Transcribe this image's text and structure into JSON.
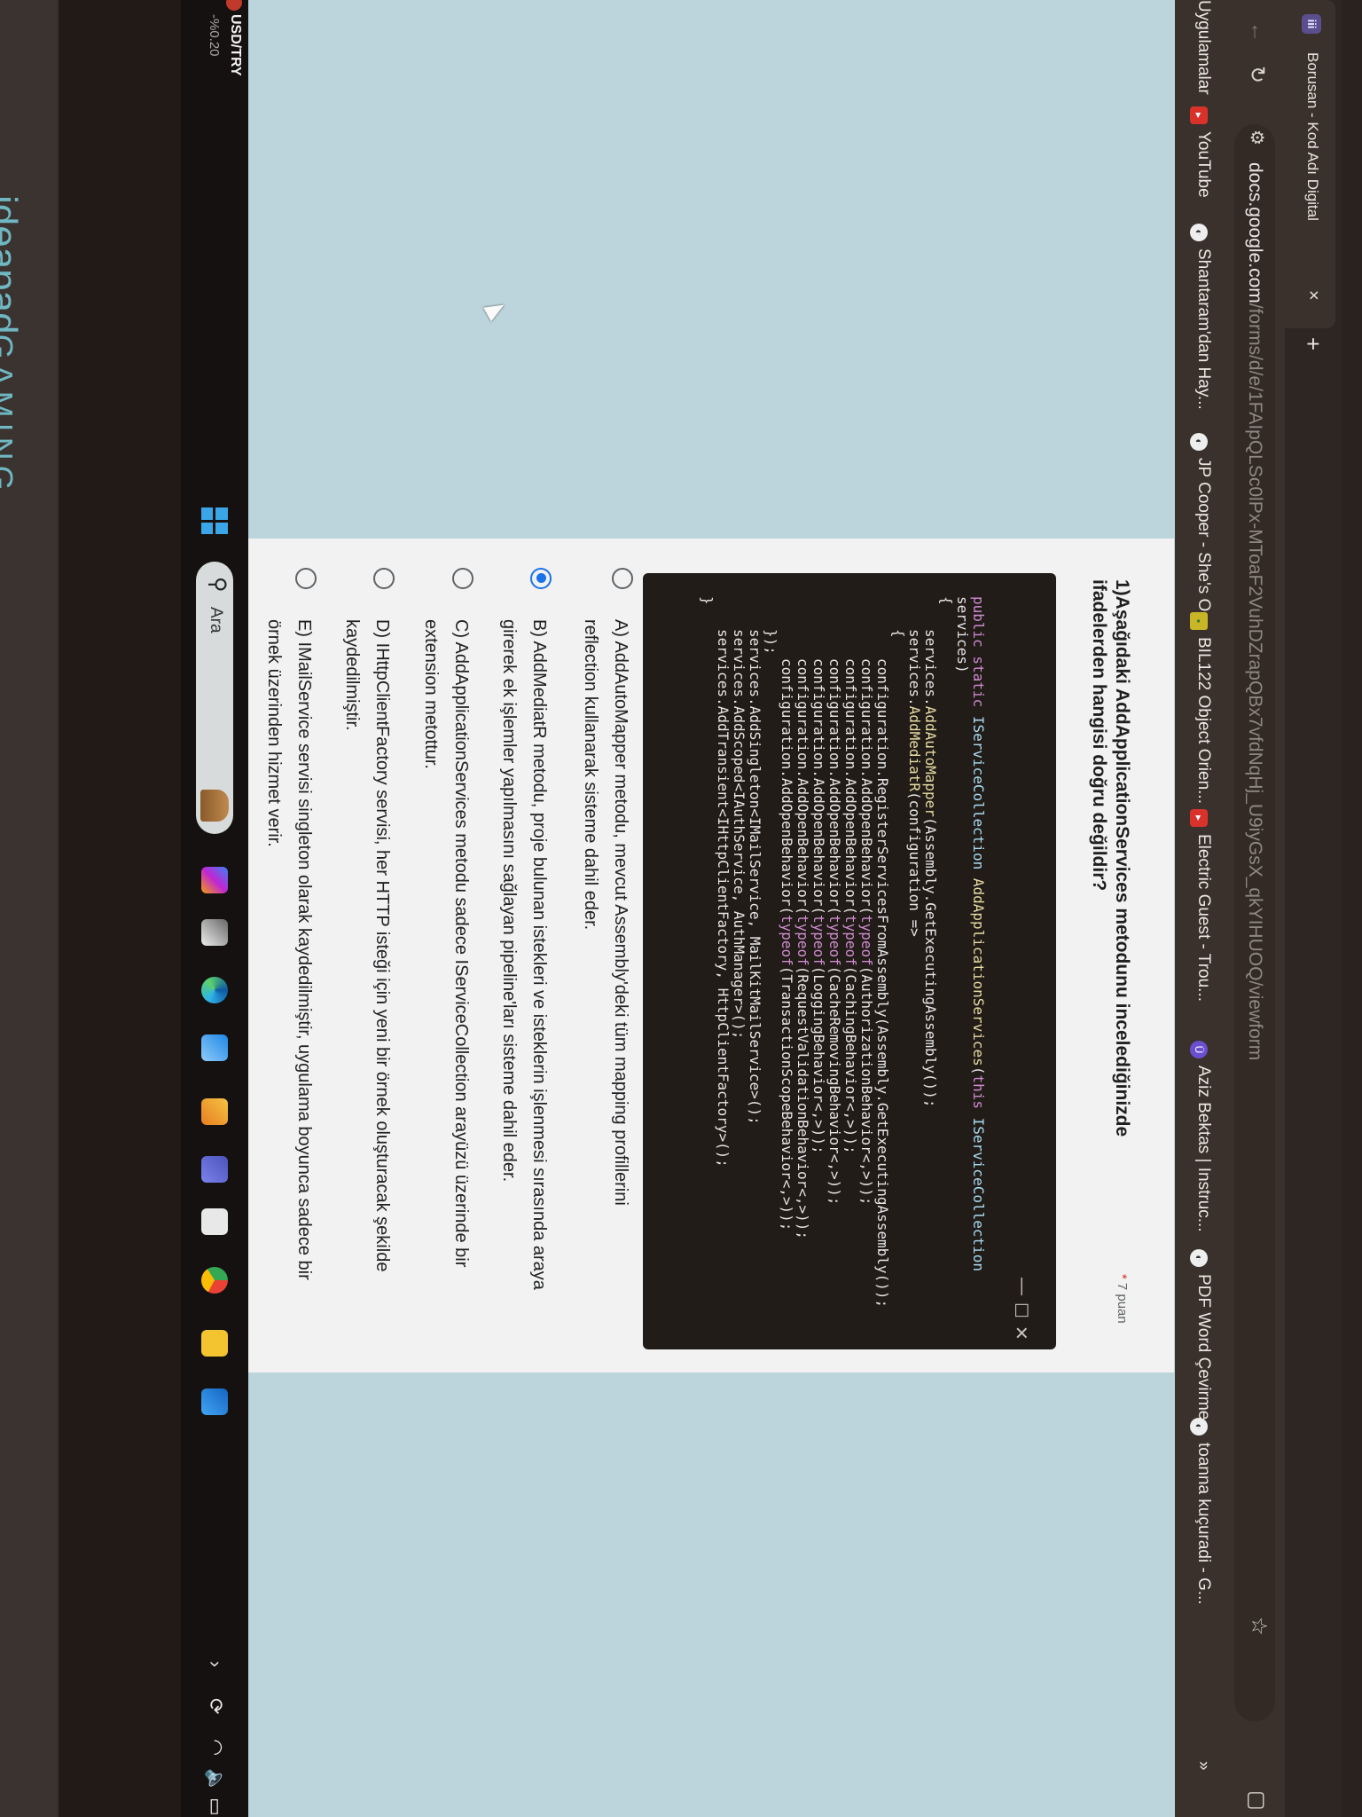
{
  "browser": {
    "tab_title": "Borusan - Kod Adı Digital",
    "tab_icon": "iii",
    "url_host": "docs.google.com",
    "url_path": "/forms/d/e/1FAIpQLSc0lPx-MToaF2VuhDZrapQBx7vfdNqHj_U9iyGsX_qkYIHUOQ/viewform",
    "bookmarks": [
      {
        "label": "Uygulamalar",
        "icon": "apps-icon"
      },
      {
        "label": "YouTube",
        "icon": "youtube-icon"
      },
      {
        "label": "Shantaram'dan Hay...",
        "icon": "globe-icon"
      },
      {
        "label": "JP Cooper - She's O...",
        "icon": "globe-icon"
      },
      {
        "label": "BIL122 Object Orien...",
        "icon": "classroom-icon"
      },
      {
        "label": "Electric Guest - Trou...",
        "icon": "youtube-icon"
      },
      {
        "label": "Aziz Bektas | Instruc...",
        "icon": "udemy-icon"
      },
      {
        "label": "PDF Word Çevirme",
        "icon": "globe-icon"
      },
      {
        "label": "toanna kuçuradi - G...",
        "icon": "globe-icon"
      }
    ],
    "bookmarks_more": "»"
  },
  "form": {
    "question_title_line1": "1)Aşağıdaki AddApplicationServices metodunu incelediğinizde",
    "question_title_line2": "ifadelerden hangisi doğru değildir?",
    "required_mark": "*",
    "points": "7 puan",
    "code_lines": [
      {
        "indent": 0,
        "tokens": [
          [
            "kw",
            "public static "
          ],
          [
            "type",
            "IServiceCollection "
          ],
          [
            "fn",
            "AddApplicationServices"
          ],
          [
            "p",
            "("
          ],
          [
            "kw",
            "this "
          ],
          [
            "type",
            "IServiceCollection"
          ]
        ]
      },
      {
        "indent": 0,
        "tokens": [
          [
            "p",
            "services)"
          ]
        ]
      },
      {
        "indent": 0,
        "tokens": [
          [
            "p",
            "{"
          ]
        ]
      },
      {
        "indent": 1,
        "tokens": [
          [
            "p",
            "services."
          ],
          [
            "fn",
            "AddAutoMapper"
          ],
          [
            "p",
            "(Assembly.GetExecutingAssembly());"
          ]
        ]
      },
      {
        "indent": 1,
        "tokens": [
          [
            "p",
            "services."
          ],
          [
            "fn",
            "AddMediatR"
          ],
          [
            "p",
            "(configuration =>"
          ]
        ]
      },
      {
        "indent": 1,
        "tokens": [
          [
            "p",
            "{"
          ]
        ]
      },
      {
        "indent": 2,
        "tokens": [
          [
            "p",
            "configuration.RegisterServicesFromAssembly(Assembly.GetExecutingAssembly());"
          ]
        ]
      },
      {
        "indent": 2,
        "tokens": [
          [
            "p",
            "configuration.AddOpenBehavior("
          ],
          [
            "kw",
            "typeof"
          ],
          [
            "p",
            "(AuthorizationBehavior<,>));"
          ]
        ]
      },
      {
        "indent": 2,
        "tokens": [
          [
            "p",
            "configuration.AddOpenBehavior("
          ],
          [
            "kw",
            "typeof"
          ],
          [
            "p",
            "(CachingBehavior<,>));"
          ]
        ]
      },
      {
        "indent": 2,
        "tokens": [
          [
            "p",
            "configuration.AddOpenBehavior("
          ],
          [
            "kw",
            "typeof"
          ],
          [
            "p",
            "(CacheRemovingBehavior<,>));"
          ]
        ]
      },
      {
        "indent": 2,
        "tokens": [
          [
            "p",
            "configuration.AddOpenBehavior("
          ],
          [
            "kw",
            "typeof"
          ],
          [
            "p",
            "(LoggingBehavior<,>));"
          ]
        ]
      },
      {
        "indent": 2,
        "tokens": [
          [
            "p",
            "configuration.AddOpenBehavior("
          ],
          [
            "kw",
            "typeof"
          ],
          [
            "p",
            "(RequestValidationBehavior<,>));"
          ]
        ]
      },
      {
        "indent": 2,
        "tokens": [
          [
            "p",
            "configuration.AddOpenBehavior("
          ],
          [
            "kw",
            "typeof"
          ],
          [
            "p",
            "(TransactionScopeBehavior<,>));"
          ]
        ]
      },
      {
        "indent": 1,
        "tokens": [
          [
            "p",
            "});"
          ]
        ]
      },
      {
        "indent": 1,
        "tokens": [
          [
            "p",
            "services.AddSingleton<IMailService, MailKitMailService>();"
          ]
        ]
      },
      {
        "indent": 1,
        "tokens": [
          [
            "p",
            "services.AddScoped<IAuthService, AuthManager>();"
          ]
        ]
      },
      {
        "indent": 1,
        "tokens": [
          [
            "p",
            "services.AddTransient<IHttpClientFactory, HttpClientFactory>();"
          ]
        ]
      },
      {
        "indent": 0,
        "tokens": [
          [
            "p",
            "}"
          ]
        ]
      }
    ],
    "window_controls": [
      "—",
      "☐",
      "✕"
    ],
    "options": [
      {
        "lines": [
          "A) AddAutoMapper metodu, mevcut Assembly'deki tüm mapping profillerini",
          "reflection kullanarak sisteme dahil eder."
        ],
        "selected": false
      },
      {
        "lines": [
          "B) AddMediatR metodu, proje bulunan istekleri ve isteklerin işlenmesi sırasında araya",
          "girerek ek işlemler yapılmasını sağlayan pipeline'ları sisteme dahil eder."
        ],
        "selected": true
      },
      {
        "lines": [
          "C) AddApplicationServices metodu sadece IServiceCollection arayüzü üzerinde bir",
          "extension metottur."
        ],
        "selected": false
      },
      {
        "lines": [
          "D) IHttpClientFactory servisi, her HTTP isteği için yeni bir örnek oluşturacak şekilde",
          "kaydedilmiştir."
        ],
        "selected": false
      },
      {
        "lines": [
          "E) IMailService servisi singleton olarak kaydedilmiştir, uygulama boyunca sadece bir",
          "örnek üzerinden hizmet verir."
        ],
        "selected": false
      }
    ],
    "accent_color": "#1a73e8"
  },
  "taskbar": {
    "widget_title": "USD/TRY",
    "widget_value": "-%0.20",
    "search_placeholder": "Ara",
    "tray_chevron": "›"
  },
  "device": {
    "brand": "ideapad",
    "brand_suffix": "GAMING"
  }
}
